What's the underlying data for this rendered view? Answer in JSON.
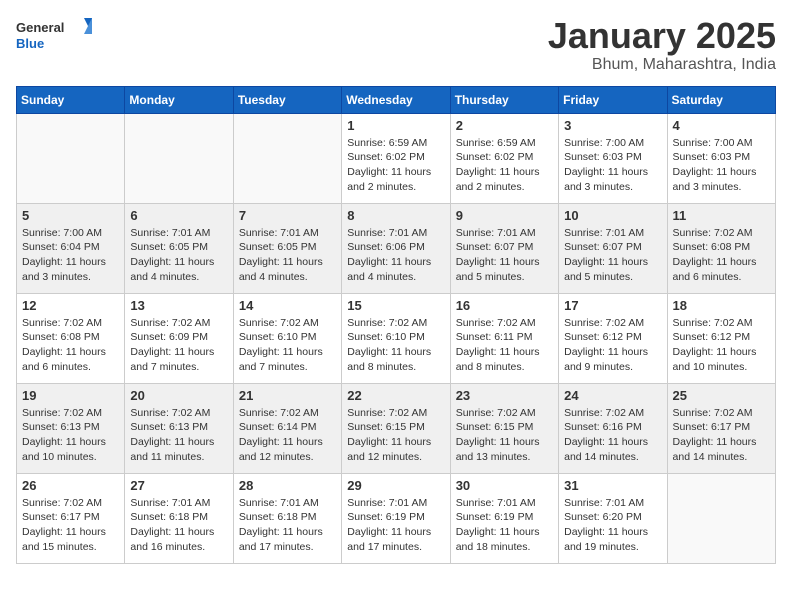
{
  "header": {
    "logo_general": "General",
    "logo_blue": "Blue",
    "month_title": "January 2025",
    "location": "Bhum, Maharashtra, India"
  },
  "calendar": {
    "days_of_week": [
      "Sunday",
      "Monday",
      "Tuesday",
      "Wednesday",
      "Thursday",
      "Friday",
      "Saturday"
    ],
    "weeks": [
      [
        {
          "day": "",
          "info": ""
        },
        {
          "day": "",
          "info": ""
        },
        {
          "day": "",
          "info": ""
        },
        {
          "day": "1",
          "info": "Sunrise: 6:59 AM\nSunset: 6:02 PM\nDaylight: 11 hours\nand 2 minutes."
        },
        {
          "day": "2",
          "info": "Sunrise: 6:59 AM\nSunset: 6:02 PM\nDaylight: 11 hours\nand 2 minutes."
        },
        {
          "day": "3",
          "info": "Sunrise: 7:00 AM\nSunset: 6:03 PM\nDaylight: 11 hours\nand 3 minutes."
        },
        {
          "day": "4",
          "info": "Sunrise: 7:00 AM\nSunset: 6:03 PM\nDaylight: 11 hours\nand 3 minutes."
        }
      ],
      [
        {
          "day": "5",
          "info": "Sunrise: 7:00 AM\nSunset: 6:04 PM\nDaylight: 11 hours\nand 3 minutes."
        },
        {
          "day": "6",
          "info": "Sunrise: 7:01 AM\nSunset: 6:05 PM\nDaylight: 11 hours\nand 4 minutes."
        },
        {
          "day": "7",
          "info": "Sunrise: 7:01 AM\nSunset: 6:05 PM\nDaylight: 11 hours\nand 4 minutes."
        },
        {
          "day": "8",
          "info": "Sunrise: 7:01 AM\nSunset: 6:06 PM\nDaylight: 11 hours\nand 4 minutes."
        },
        {
          "day": "9",
          "info": "Sunrise: 7:01 AM\nSunset: 6:07 PM\nDaylight: 11 hours\nand 5 minutes."
        },
        {
          "day": "10",
          "info": "Sunrise: 7:01 AM\nSunset: 6:07 PM\nDaylight: 11 hours\nand 5 minutes."
        },
        {
          "day": "11",
          "info": "Sunrise: 7:02 AM\nSunset: 6:08 PM\nDaylight: 11 hours\nand 6 minutes."
        }
      ],
      [
        {
          "day": "12",
          "info": "Sunrise: 7:02 AM\nSunset: 6:08 PM\nDaylight: 11 hours\nand 6 minutes."
        },
        {
          "day": "13",
          "info": "Sunrise: 7:02 AM\nSunset: 6:09 PM\nDaylight: 11 hours\nand 7 minutes."
        },
        {
          "day": "14",
          "info": "Sunrise: 7:02 AM\nSunset: 6:10 PM\nDaylight: 11 hours\nand 7 minutes."
        },
        {
          "day": "15",
          "info": "Sunrise: 7:02 AM\nSunset: 6:10 PM\nDaylight: 11 hours\nand 8 minutes."
        },
        {
          "day": "16",
          "info": "Sunrise: 7:02 AM\nSunset: 6:11 PM\nDaylight: 11 hours\nand 8 minutes."
        },
        {
          "day": "17",
          "info": "Sunrise: 7:02 AM\nSunset: 6:12 PM\nDaylight: 11 hours\nand 9 minutes."
        },
        {
          "day": "18",
          "info": "Sunrise: 7:02 AM\nSunset: 6:12 PM\nDaylight: 11 hours\nand 10 minutes."
        }
      ],
      [
        {
          "day": "19",
          "info": "Sunrise: 7:02 AM\nSunset: 6:13 PM\nDaylight: 11 hours\nand 10 minutes."
        },
        {
          "day": "20",
          "info": "Sunrise: 7:02 AM\nSunset: 6:13 PM\nDaylight: 11 hours\nand 11 minutes."
        },
        {
          "day": "21",
          "info": "Sunrise: 7:02 AM\nSunset: 6:14 PM\nDaylight: 11 hours\nand 12 minutes."
        },
        {
          "day": "22",
          "info": "Sunrise: 7:02 AM\nSunset: 6:15 PM\nDaylight: 11 hours\nand 12 minutes."
        },
        {
          "day": "23",
          "info": "Sunrise: 7:02 AM\nSunset: 6:15 PM\nDaylight: 11 hours\nand 13 minutes."
        },
        {
          "day": "24",
          "info": "Sunrise: 7:02 AM\nSunset: 6:16 PM\nDaylight: 11 hours\nand 14 minutes."
        },
        {
          "day": "25",
          "info": "Sunrise: 7:02 AM\nSunset: 6:17 PM\nDaylight: 11 hours\nand 14 minutes."
        }
      ],
      [
        {
          "day": "26",
          "info": "Sunrise: 7:02 AM\nSunset: 6:17 PM\nDaylight: 11 hours\nand 15 minutes."
        },
        {
          "day": "27",
          "info": "Sunrise: 7:01 AM\nSunset: 6:18 PM\nDaylight: 11 hours\nand 16 minutes."
        },
        {
          "day": "28",
          "info": "Sunrise: 7:01 AM\nSunset: 6:18 PM\nDaylight: 11 hours\nand 17 minutes."
        },
        {
          "day": "29",
          "info": "Sunrise: 7:01 AM\nSunset: 6:19 PM\nDaylight: 11 hours\nand 17 minutes."
        },
        {
          "day": "30",
          "info": "Sunrise: 7:01 AM\nSunset: 6:19 PM\nDaylight: 11 hours\nand 18 minutes."
        },
        {
          "day": "31",
          "info": "Sunrise: 7:01 AM\nSunset: 6:20 PM\nDaylight: 11 hours\nand 19 minutes."
        },
        {
          "day": "",
          "info": ""
        }
      ]
    ]
  }
}
